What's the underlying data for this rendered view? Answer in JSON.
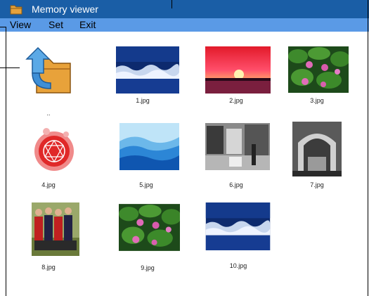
{
  "window": {
    "title": "Memory viewer",
    "icon": "folder-icon"
  },
  "menu": {
    "items": [
      "View",
      "Set",
      "Exit"
    ]
  },
  "files": [
    {
      "name": "..",
      "kind": "parent-folder",
      "icon": "folder-up-icon"
    },
    {
      "name": "1.jpg",
      "kind": "image",
      "thumb": "blue-waves"
    },
    {
      "name": "2.jpg",
      "kind": "image",
      "thumb": "sunset"
    },
    {
      "name": "3.jpg",
      "kind": "image",
      "thumb": "water-lilies"
    },
    {
      "name": "4.jpg",
      "kind": "image",
      "thumb": "red-emblem"
    },
    {
      "name": "5.jpg",
      "kind": "image",
      "thumb": "blue-hills"
    },
    {
      "name": "6.jpg",
      "kind": "image",
      "thumb": "street-bw"
    },
    {
      "name": "7.jpg",
      "kind": "image",
      "thumb": "arch-bw"
    },
    {
      "name": "8.jpg",
      "kind": "image",
      "thumb": "team-photo"
    },
    {
      "name": "9.jpg",
      "kind": "image",
      "thumb": "water-lilies"
    },
    {
      "name": "10.jpg",
      "kind": "image",
      "thumb": "blue-waves"
    }
  ]
}
